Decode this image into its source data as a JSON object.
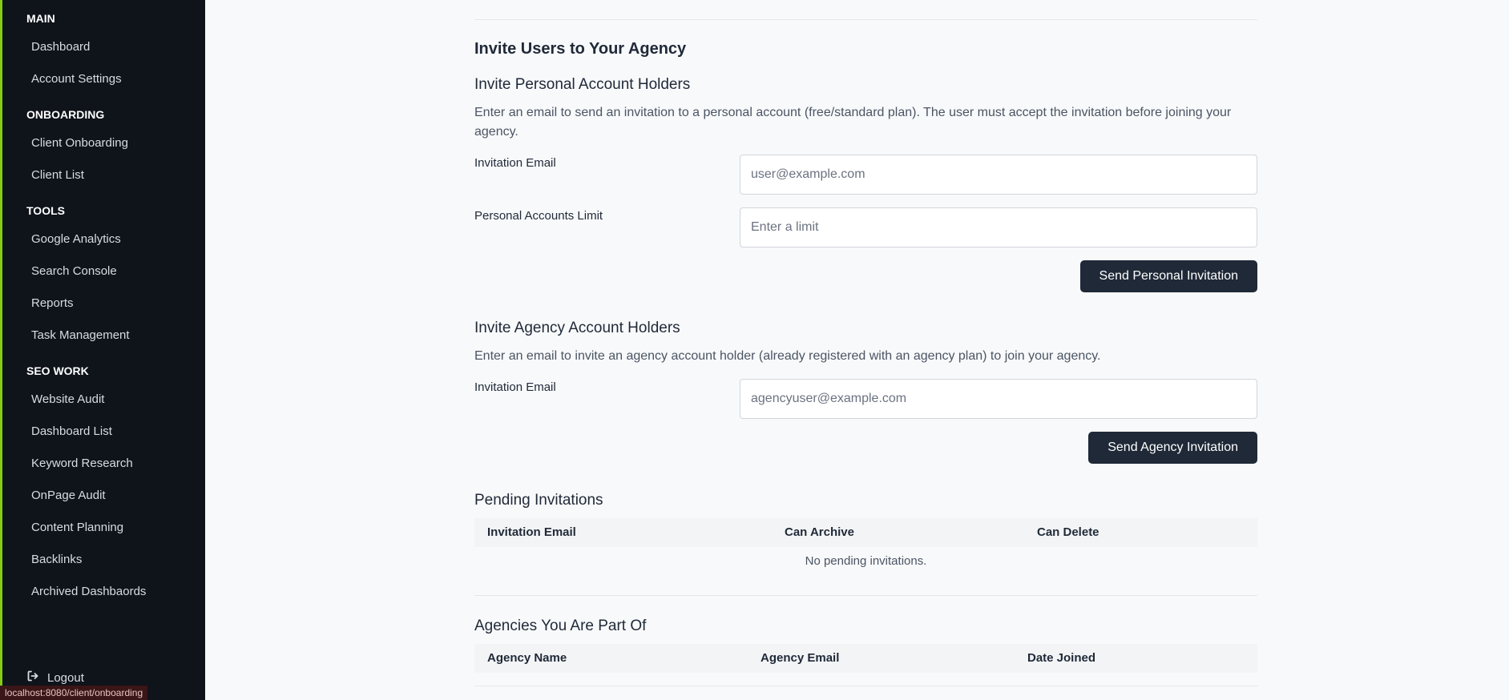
{
  "sidebar": {
    "sections": [
      {
        "title": "MAIN",
        "items": [
          "Dashboard",
          "Account Settings"
        ]
      },
      {
        "title": "ONBOARDING",
        "items": [
          "Client Onboarding",
          "Client List"
        ]
      },
      {
        "title": "TOOLS",
        "items": [
          "Google Analytics",
          "Search Console",
          "Reports",
          "Task Management"
        ]
      },
      {
        "title": "SEO WORK",
        "items": [
          "Website Audit",
          "Dashboard List",
          "Keyword Research",
          "OnPage Audit",
          "Content Planning",
          "Backlinks",
          "Archived Dashbaords"
        ]
      }
    ],
    "logout_label": "Logout",
    "status_url": "localhost:8080/client/onboarding"
  },
  "invite": {
    "title": "Invite Users to Your Agency",
    "personal": {
      "heading": "Invite Personal Account Holders",
      "description": "Enter an email to send an invitation to a personal account (free/standard plan). The user must accept the invitation before joining your agency.",
      "email_label": "Invitation Email",
      "email_placeholder": "user@example.com",
      "limit_label": "Personal Accounts Limit",
      "limit_placeholder": "Enter a limit",
      "button": "Send Personal Invitation"
    },
    "agency": {
      "heading": "Invite Agency Account Holders",
      "description": "Enter an email to invite an agency account holder (already registered with an agency plan) to join your agency.",
      "email_label": "Invitation Email",
      "email_placeholder": "agencyuser@example.com",
      "button": "Send Agency Invitation"
    }
  },
  "pending": {
    "heading": "Pending Invitations",
    "columns": [
      "Invitation Email",
      "Can Archive",
      "Can Delete"
    ],
    "empty_text": "No pending invitations."
  },
  "agencies": {
    "heading": "Agencies You Are Part Of",
    "columns": [
      "Agency Name",
      "Agency Email",
      "Date Joined"
    ]
  },
  "colors": {
    "sidebar_bg": "#0f131a",
    "accent": "#84cc16",
    "button_bg": "#1f2937"
  }
}
